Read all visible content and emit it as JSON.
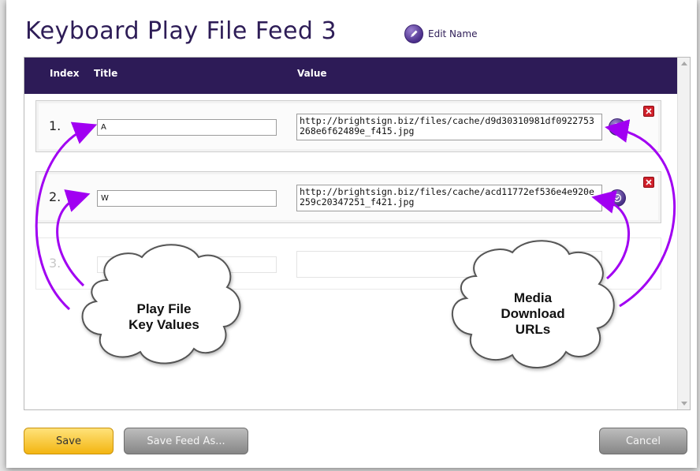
{
  "page": {
    "title": "Keyboard Play File Feed 3",
    "edit_name_label": "Edit Name",
    "edit_name_icon": "pencil-icon"
  },
  "table": {
    "columns": {
      "index": "Index",
      "title": "Title",
      "value": "Value"
    },
    "rows": [
      {
        "index": "1.",
        "title": "A",
        "value": "http://brightsign.biz/files/cache/d9d30310981df0922753268e6f62489e_f415.jpg"
      },
      {
        "index": "2.",
        "title": "W",
        "value": "http://brightsign.biz/files/cache/acd11772ef536e4e920e259c20347251_f421.jpg"
      },
      {
        "index": "3.",
        "title": "",
        "value": ""
      }
    ]
  },
  "callouts": {
    "left": {
      "line1": "Play File",
      "line2": "Key Values"
    },
    "right": {
      "line1": "Media",
      "line2": "Download",
      "line3": "URLs"
    }
  },
  "buttons": {
    "save": "Save",
    "save_feed_as": "Save Feed As...",
    "cancel": "Cancel"
  },
  "colors": {
    "header_bg": "#2d1b57",
    "title_text": "#2e1d57",
    "arrow": "#a100f2",
    "save_button": "#f3b511",
    "delete_button": "#d0202a"
  }
}
